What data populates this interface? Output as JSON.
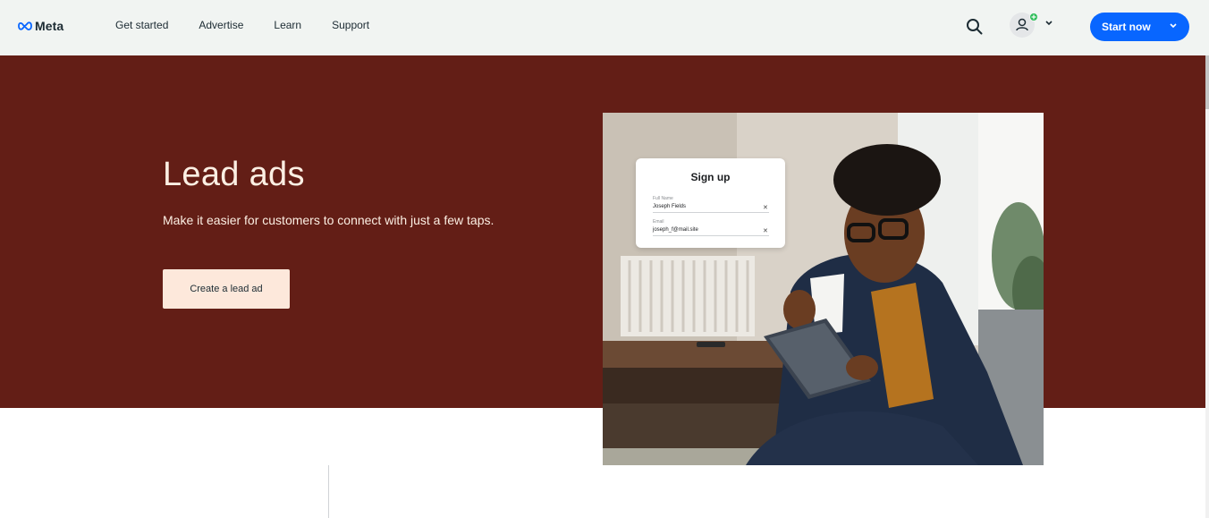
{
  "brand": {
    "name": "Meta",
    "accent": "#0866ff",
    "hero_bg": "#631e16",
    "hero_text": "#fcefe3",
    "cta_bg": "#fde8db"
  },
  "nav": {
    "links": [
      {
        "label": "Get started"
      },
      {
        "label": "Advertise"
      },
      {
        "label": "Learn"
      },
      {
        "label": "Support"
      }
    ],
    "search_icon": "search-icon",
    "account_icon": "user-icon",
    "start_label": "Start now"
  },
  "hero": {
    "title": "Lead ads",
    "description": "Make it easier for customers to connect with just a few taps.",
    "cta_label": "Create a lead ad"
  },
  "signup_card": {
    "title": "Sign up",
    "fields": [
      {
        "label": "Full Name",
        "value": "Joseph Fields"
      },
      {
        "label": "Email",
        "value": "joseph_f@mail.site"
      }
    ]
  }
}
